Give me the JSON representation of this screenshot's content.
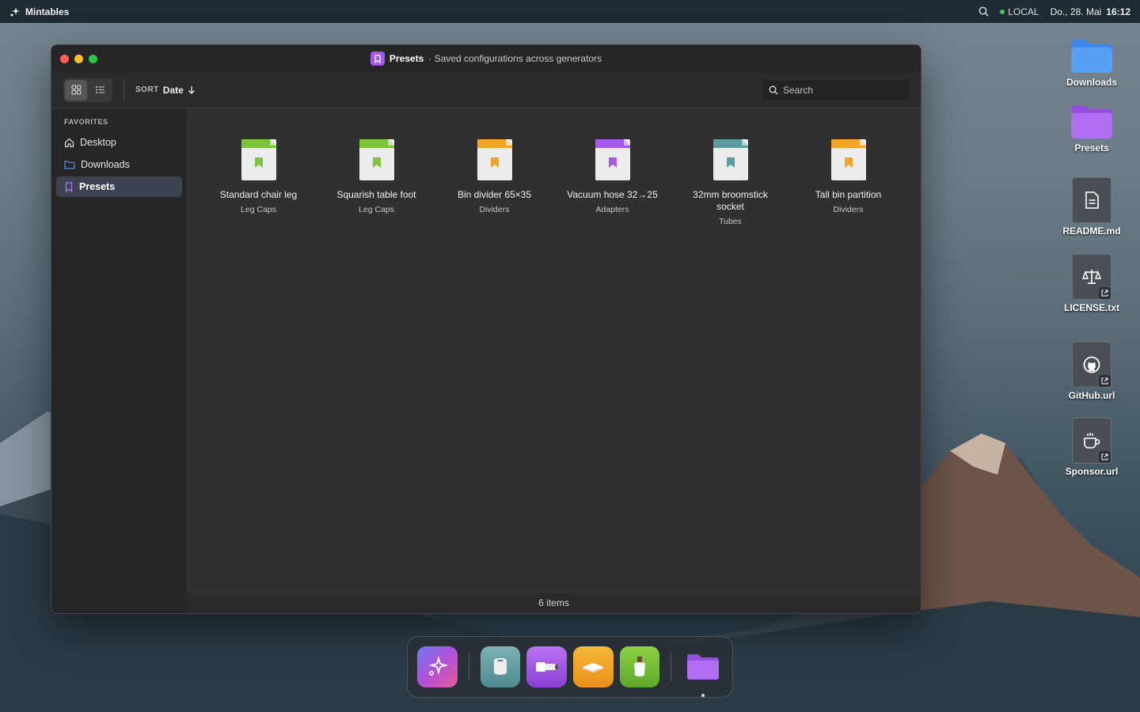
{
  "menubar": {
    "app_name": "Mintables",
    "status": "LOCAL",
    "date": "Do., 28. Mai",
    "time": "16:12"
  },
  "window": {
    "title": "Presets",
    "subtitle": "Saved configurations across generators"
  },
  "toolbar": {
    "sort_label": "SORT",
    "sort_value": "Date",
    "search_placeholder": "Search"
  },
  "sidebar": {
    "section": "FAVORITES",
    "items": [
      {
        "label": "Desktop",
        "icon": "home-icon"
      },
      {
        "label": "Downloads",
        "icon": "folder-icon"
      },
      {
        "label": "Presets",
        "icon": "bookmark-icon",
        "active": true
      }
    ]
  },
  "files": [
    {
      "name": "Standard chair leg",
      "category": "Leg Caps",
      "color": "#7cc43a"
    },
    {
      "name": "Squarish table foot",
      "category": "Leg Caps",
      "color": "#7cc43a"
    },
    {
      "name": "Bin divider 65×35",
      "category": "Dividers",
      "color": "#f0a526"
    },
    {
      "name": "Vacuum hose 32→25",
      "category": "Adapters",
      "color": "#a35ae8"
    },
    {
      "name": "32mm broomstick socket",
      "category": "Tubes",
      "color": "#5a9aa0"
    },
    {
      "name": "Tall bin partition",
      "category": "Dividers",
      "color": "#f0a526"
    }
  ],
  "status": {
    "count": "6 items"
  },
  "desktop": {
    "icons": [
      {
        "label": "Downloads",
        "icon": "folder-icon"
      },
      {
        "label": "Presets",
        "icon": "folder-icon"
      },
      {
        "label": "README.md",
        "icon": "document-icon"
      },
      {
        "label": "LICENSE.txt",
        "icon": "scale-icon"
      },
      {
        "label": "GitHub.url",
        "icon": "github-icon"
      },
      {
        "label": "Sponsor.url",
        "icon": "coffee-icon"
      }
    ]
  },
  "dock": {
    "apps": [
      "mintables-app",
      "tube-app",
      "hose-app",
      "divider-app",
      "leg-cap-app",
      "files-app"
    ]
  }
}
